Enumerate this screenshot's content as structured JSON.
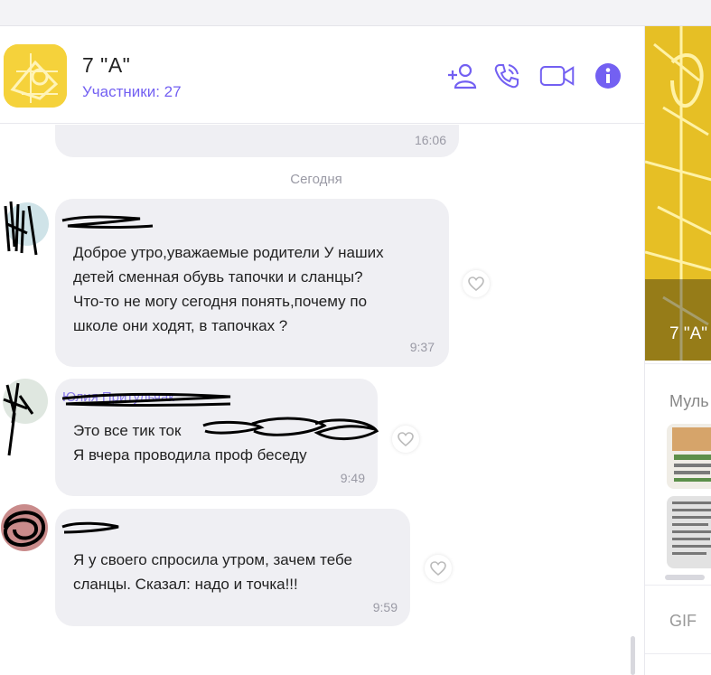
{
  "window": {
    "colors": {
      "accent": "#7360f2",
      "bubble": "#efeff3"
    }
  },
  "header": {
    "title": "7 \"А\"",
    "participants": "Участники: 27",
    "icons": [
      "add-participant-icon",
      "call-icon",
      "video-call-icon",
      "info-icon"
    ]
  },
  "messages": {
    "prev_time": "16:06",
    "date_separator": "Сегодня",
    "items": [
      {
        "lines": [
          "Доброе утро,уважаемые родители У наших",
          "детей сменная обувь тапочки и сланцы?",
          "Что-то не могу сегодня понять,почему по",
          "школе они ходят, в  тапочках ?"
        ],
        "time": "9:37"
      },
      {
        "sender": "Юлия Притульчак",
        "lines": [
          "Это все тик ток",
          "Я вчера проводила проф беседу"
        ],
        "time": "9:49"
      },
      {
        "lines": [
          "Я у своего спросила утром, зачем тебе",
          "сланцы. Сказал: надо и точка!!!"
        ],
        "time": "9:59"
      }
    ]
  },
  "side_panel": {
    "chat_title": "7 \"А\"",
    "media_label": "Муль",
    "gif_label": "GIF"
  }
}
